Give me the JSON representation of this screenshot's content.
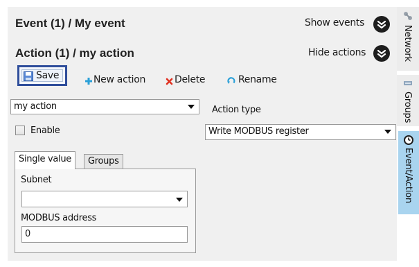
{
  "header": {
    "event_title": "Event (1) / My event",
    "show_events_label": "Show events",
    "action_title": "Action (1) / my action",
    "hide_actions_label": "Hide actions"
  },
  "toolbar": {
    "save_label": "Save",
    "new_action_label": "New action",
    "delete_label": "Delete",
    "rename_label": "Rename"
  },
  "form": {
    "action_select_value": "my action",
    "action_type_label": "Action type",
    "action_type_value": "Write MODBUS register",
    "enable_label": "Enable",
    "enable_checked": false
  },
  "tabs": [
    {
      "label": "Single value",
      "active": true
    },
    {
      "label": "Groups",
      "active": false
    }
  ],
  "single_value": {
    "subnet_label": "Subnet",
    "subnet_value": "",
    "modbus_address_label": "MODBUS address",
    "modbus_address_value": "0"
  },
  "side_tabs": [
    {
      "label": "Network",
      "icon": "network-icon",
      "active": false
    },
    {
      "label": "Groups",
      "icon": "groups-icon",
      "active": false
    },
    {
      "label": "Event/Action",
      "icon": "clock-icon",
      "active": true
    }
  ],
  "colors": {
    "panel_bg": "#f0f0f0",
    "save_highlight": "#2f4e9b",
    "active_side_tab": "#a9d4ef",
    "delete_icon": "#e03020",
    "add_icon": "#2aa0d8"
  }
}
